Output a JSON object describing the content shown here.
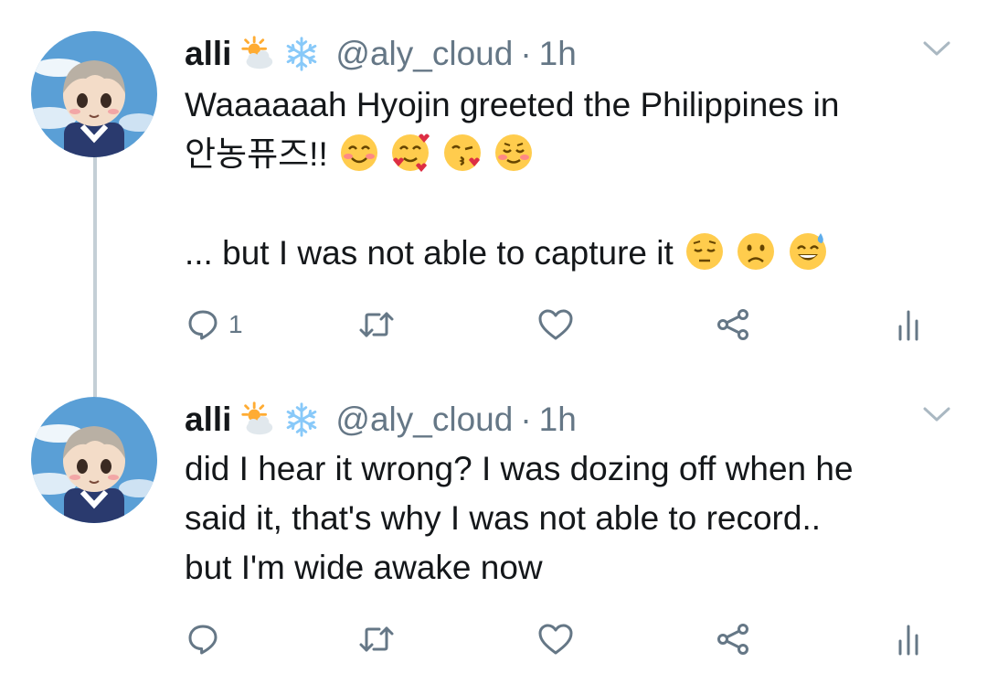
{
  "tweets": [
    {
      "display_name": "alli",
      "name_emojis": [
        "sun-behind-cloud-emoji",
        "snowflake-emoji"
      ],
      "handle": "@aly_cloud",
      "separator": "·",
      "time": "1h",
      "lines": [
        "Waaaaaah Hyojin greeted the Philippines in",
        "안농퓨즈!!",
        "",
        "... but I was not able to capture it"
      ],
      "line2_emojis": [
        "blushing-smile-emoji",
        "smiling-face-with-hearts-emoji",
        "face-blowing-kiss-emoji",
        "smiling-face-emoji"
      ],
      "line4_emojis": [
        "pensive-face-emoji",
        "frowning-face-emoji",
        "grinning-face-with-sweat-emoji"
      ],
      "reply_count": "1",
      "actions": [
        "reply-icon",
        "retweet-icon",
        "like-icon",
        "share-icon",
        "analytics-icon"
      ]
    },
    {
      "display_name": "alli",
      "name_emojis": [
        "sun-behind-cloud-emoji",
        "snowflake-emoji"
      ],
      "handle": "@aly_cloud",
      "separator": "·",
      "time": "1h",
      "lines": [
        "did I hear it wrong? I was dozing off when he",
        "said it, that's why I was not able to record..",
        "but I'm wide awake now"
      ],
      "reply_count": "",
      "actions": [
        "reply-icon",
        "retweet-icon",
        "like-icon",
        "share-icon",
        "analytics-icon"
      ]
    }
  ],
  "colors": {
    "text": "#14171a",
    "secondary": "#657786",
    "thread_line": "#c4cfd6",
    "icon": "#657786"
  }
}
